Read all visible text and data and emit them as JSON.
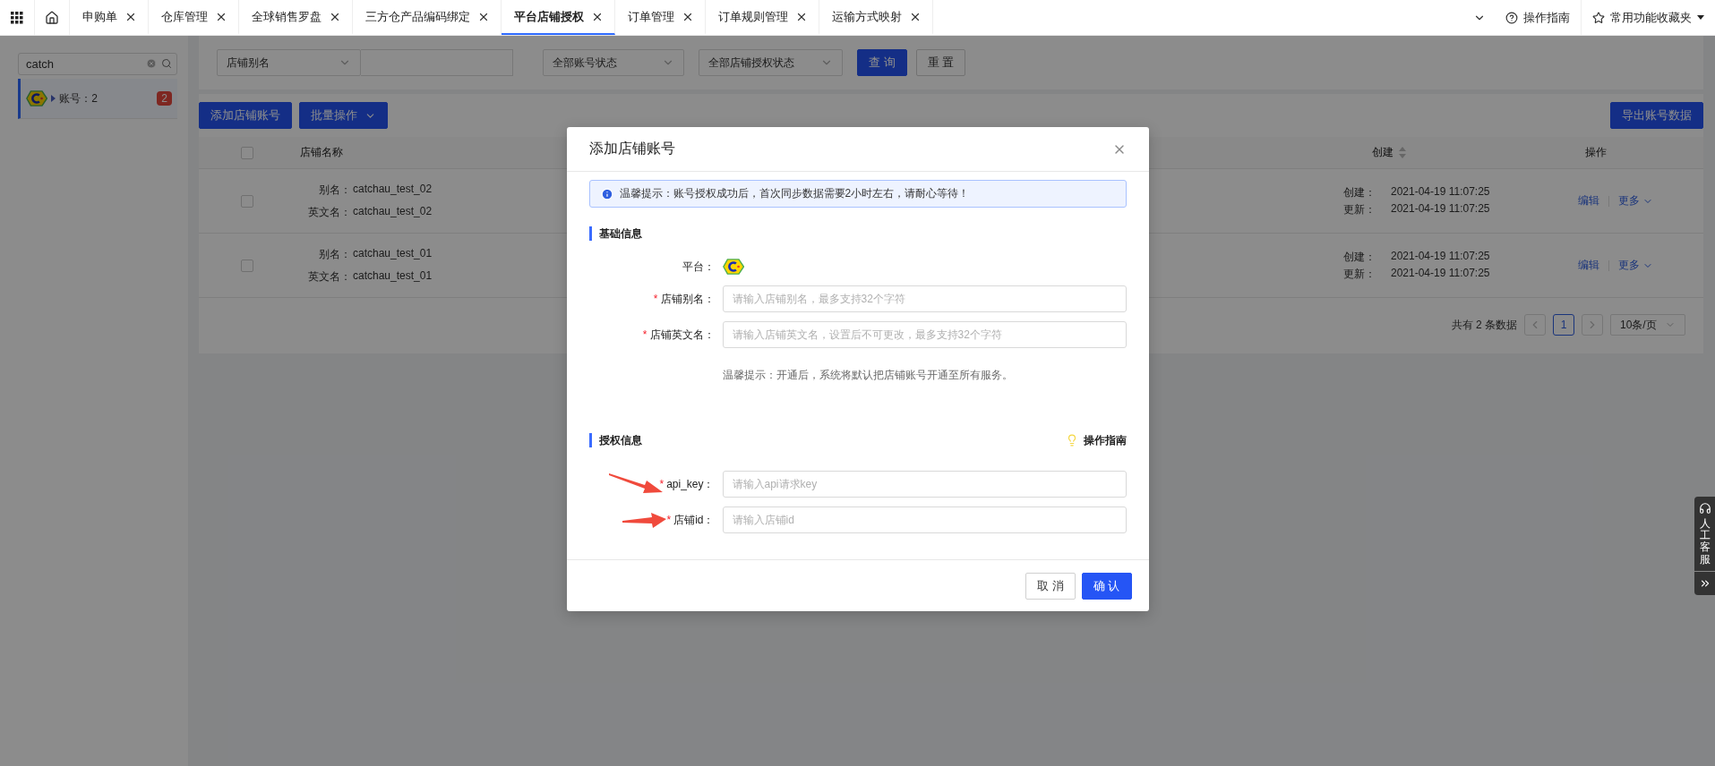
{
  "top_tabs": {
    "tabs": [
      {
        "label": "申购单",
        "selected": false
      },
      {
        "label": "仓库管理",
        "selected": false
      },
      {
        "label": "全球销售罗盘",
        "selected": false
      },
      {
        "label": "三方仓产品编码绑定",
        "selected": false
      },
      {
        "label": "平台店铺授权",
        "selected": true
      },
      {
        "label": "订单管理",
        "selected": false
      },
      {
        "label": "订单规则管理",
        "selected": false
      },
      {
        "label": "运输方式映射",
        "selected": false
      }
    ],
    "guide": "操作指南",
    "favorites": "常用功能收藏夹"
  },
  "sidebar": {
    "search": {
      "value": "catch"
    },
    "items": [
      {
        "label": "账号：2",
        "count": "2",
        "selected": true
      }
    ]
  },
  "filters": {
    "field_select": "店铺别名",
    "account_status": "全部账号状态",
    "auth_status": "全部店铺授权状态",
    "buttons": [
      {
        "label": "查 询",
        "kind": "primary"
      },
      {
        "label": "重 置",
        "kind": "secondary"
      }
    ]
  },
  "toolbar": {
    "add": "添加店铺账号",
    "batch": "批量操作",
    "export": "导出账号数据"
  },
  "table": {
    "header_checked": false,
    "columns": [
      {
        "label": "店铺名称",
        "sortable": false
      },
      {
        "label": "创建",
        "sortable": true
      },
      {
        "label": "操作",
        "sortable": false
      }
    ],
    "rows": [
      {
        "checked": false,
        "alias_label": "别名：",
        "alias": "catchau_test_02",
        "en_label": "英文名：",
        "en": "catchau_test_02",
        "created_label": "创建：",
        "created": "2021-04-19 11:07:25",
        "updated_label": "更新：",
        "updated": "2021-04-19 11:07:25",
        "edit": "编辑",
        "more": "更多"
      },
      {
        "checked": false,
        "alias_label": "别名：",
        "alias": "catchau_test_01",
        "en_label": "英文名：",
        "en": "catchau_test_01",
        "created_label": "创建：",
        "created": "2021-04-19 11:07:25",
        "updated_label": "更新：",
        "updated": "2021-04-19 11:07:25",
        "edit": "编辑",
        "more": "更多"
      }
    ]
  },
  "pagination": {
    "total": "共有 2 条数据",
    "pages": [
      {
        "label": "1",
        "selected": true
      }
    ],
    "page_size": "10条/页"
  },
  "modal": {
    "title": "添加店铺账号",
    "notice": "温馨提示：账号授权成功后，首次同步数据需要2小时左右，请耐心等待！",
    "sections": [
      {
        "title": "基础信息",
        "fields": [
          {
            "kind": "platform",
            "label": "平台："
          },
          {
            "kind": "input",
            "required_mark": "*",
            "label": "店铺别名：",
            "placeholder": "请输入店铺别名，最多支持32个字符"
          },
          {
            "kind": "input",
            "required_mark": "*",
            "label": "店铺英文名：",
            "placeholder": "请输入店铺英文名，设置后不可更改，最多支持32个字符"
          },
          {
            "kind": "hint",
            "text": "温馨提示：开通后，系统将默认把店铺账号开通至所有服务。"
          }
        ]
      },
      {
        "title": "授权信息",
        "guide": "操作指南",
        "fields": [
          {
            "kind": "input",
            "required_mark": "*",
            "label": "api_key：",
            "placeholder": "请输入api请求key",
            "arrow": true
          },
          {
            "kind": "input",
            "required_mark": "*",
            "label": "店铺id：",
            "placeholder": "请输入店铺id",
            "arrow": true
          }
        ]
      }
    ],
    "buttons": [
      {
        "label": "取 消",
        "kind": "secondary"
      },
      {
        "label": "确 认",
        "kind": "primary"
      }
    ]
  },
  "service_widget": {
    "label": "人工客服"
  }
}
